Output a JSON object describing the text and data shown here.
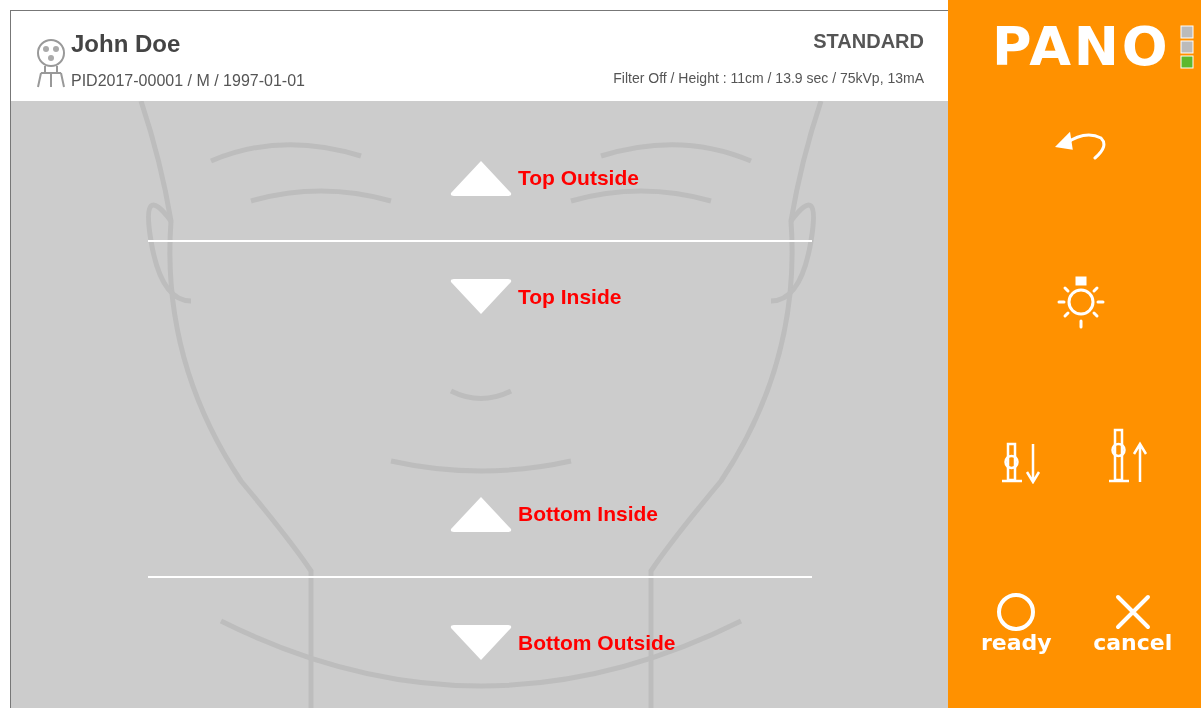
{
  "patient": {
    "name": "John Doe",
    "info": "PID2017-00001 / M / 1997-01-01"
  },
  "protocol": {
    "mode": "STANDARD",
    "parameters": "Filter Off / Height : 11cm / 13.9 sec / 75kVp, 13mA"
  },
  "logo": "PANO",
  "guides": [
    {
      "label": "Top Outside",
      "kind": "up"
    },
    {
      "label": "Top Inside",
      "kind": "down"
    },
    {
      "label": "Bottom Inside",
      "kind": "up"
    },
    {
      "label": "Bottom Outside",
      "kind": "down"
    }
  ],
  "actions": [
    {
      "label": "ready",
      "kind": "ready"
    },
    {
      "label": "cancel",
      "kind": "cancel"
    }
  ]
}
